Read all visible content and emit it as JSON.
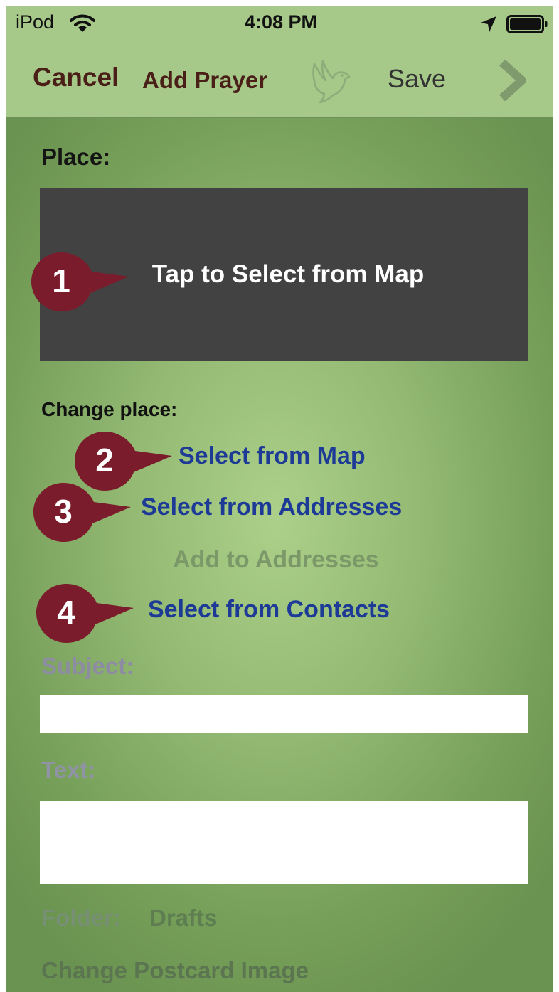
{
  "status_bar": {
    "carrier": "iPod",
    "time": "4:08 PM"
  },
  "nav": {
    "cancel_label": "Cancel",
    "title": "Add Prayer",
    "save_label": "Save"
  },
  "place": {
    "label": "Place:",
    "map_prompt": "Tap to Select from Map"
  },
  "change_place": {
    "label": "Change place:",
    "select_map": "Select from Map",
    "select_addresses": "Select from Addresses",
    "add_addresses": "Add to Addresses",
    "select_contacts": "Select from Contacts"
  },
  "subject": {
    "label": "Subject:",
    "value": ""
  },
  "text": {
    "label": "Text:",
    "value": ""
  },
  "folder": {
    "label": "Folder:",
    "value": "Drafts"
  },
  "postcard": {
    "label": "Change Postcard Image"
  },
  "callouts": {
    "c1": "1",
    "c2": "2",
    "c3": "3",
    "c4": "4"
  },
  "colors": {
    "nav_bar": "#a6c98a",
    "link_blue": "#1c3a96",
    "callout": "#7b1c2c",
    "map_box": "#424242"
  }
}
